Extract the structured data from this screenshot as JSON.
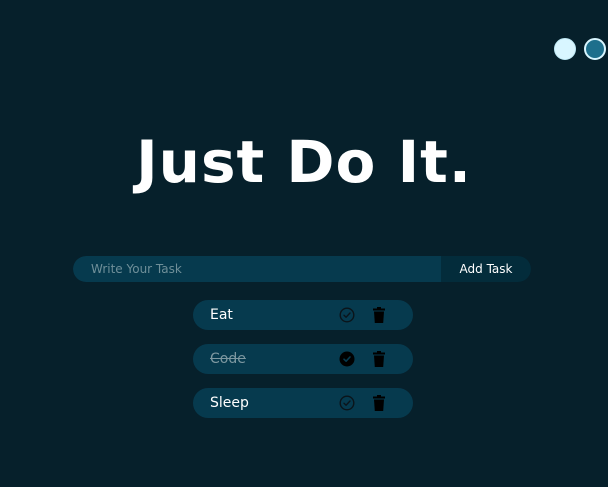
{
  "title": "Just Do It.",
  "form": {
    "placeholder": "Write Your Task",
    "value": "",
    "add_label": "Add Task"
  },
  "theme": {
    "options": [
      "light-theme",
      "dark-theme"
    ],
    "selected": "dark-theme",
    "colors": {
      "light": "#d8f6ff",
      "dark": "#1d6f8c"
    }
  },
  "tasks": [
    {
      "label": "Eat",
      "completed": false
    },
    {
      "label": "Code",
      "completed": true
    },
    {
      "label": "Sleep",
      "completed": false
    }
  ],
  "colors": {
    "background": "#06202b",
    "surface": "#063a4e",
    "button": "#032c3b",
    "text": "#ffffff",
    "muted_text": "#7c97a0"
  }
}
